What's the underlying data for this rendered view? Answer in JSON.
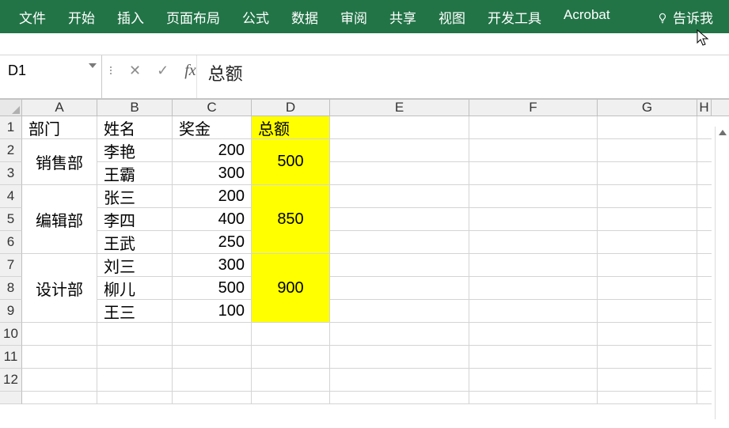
{
  "ribbon": {
    "tabs": [
      "文件",
      "开始",
      "插入",
      "页面布局",
      "公式",
      "数据",
      "审阅",
      "共享",
      "视图",
      "开发工具",
      "Acrobat"
    ],
    "tell_me": "告诉我"
  },
  "formula_bar": {
    "name_box": "D1",
    "cancel_icon": "✕",
    "enter_icon": "✓",
    "fx_label": "fx",
    "value": "总额"
  },
  "columns": [
    "A",
    "B",
    "C",
    "D",
    "E",
    "F",
    "G",
    "H"
  ],
  "row_numbers": [
    "1",
    "2",
    "3",
    "4",
    "5",
    "6",
    "7",
    "8",
    "9",
    "10",
    "11",
    "12"
  ],
  "sheet": {
    "header": {
      "dept": "部门",
      "name": "姓名",
      "bonus": "奖金",
      "total": "总额"
    },
    "groups": [
      {
        "dept": "销售部",
        "total": "500",
        "rows": [
          {
            "name": "李艳",
            "bonus": "200"
          },
          {
            "name": "王霸",
            "bonus": "300"
          }
        ]
      },
      {
        "dept": "编辑部",
        "total": "850",
        "rows": [
          {
            "name": "张三",
            "bonus": "200"
          },
          {
            "name": "李四",
            "bonus": "400"
          },
          {
            "name": "王武",
            "bonus": "250"
          }
        ]
      },
      {
        "dept": "设计部",
        "total": "900",
        "rows": [
          {
            "name": "刘三",
            "bonus": "300"
          },
          {
            "name": "柳儿",
            "bonus": "500"
          },
          {
            "name": "王三",
            "bonus": "100"
          }
        ]
      }
    ]
  },
  "chart_data": {
    "type": "table",
    "title": "",
    "columns": [
      "部门",
      "姓名",
      "奖金",
      "总额"
    ],
    "rows": [
      [
        "销售部",
        "李艳",
        200,
        500
      ],
      [
        "销售部",
        "王霸",
        300,
        500
      ],
      [
        "编辑部",
        "张三",
        200,
        850
      ],
      [
        "编辑部",
        "李四",
        400,
        850
      ],
      [
        "编辑部",
        "王武",
        250,
        850
      ],
      [
        "设计部",
        "刘三",
        300,
        900
      ],
      [
        "设计部",
        "柳儿",
        500,
        900
      ],
      [
        "设计部",
        "王三",
        100,
        900
      ]
    ]
  }
}
